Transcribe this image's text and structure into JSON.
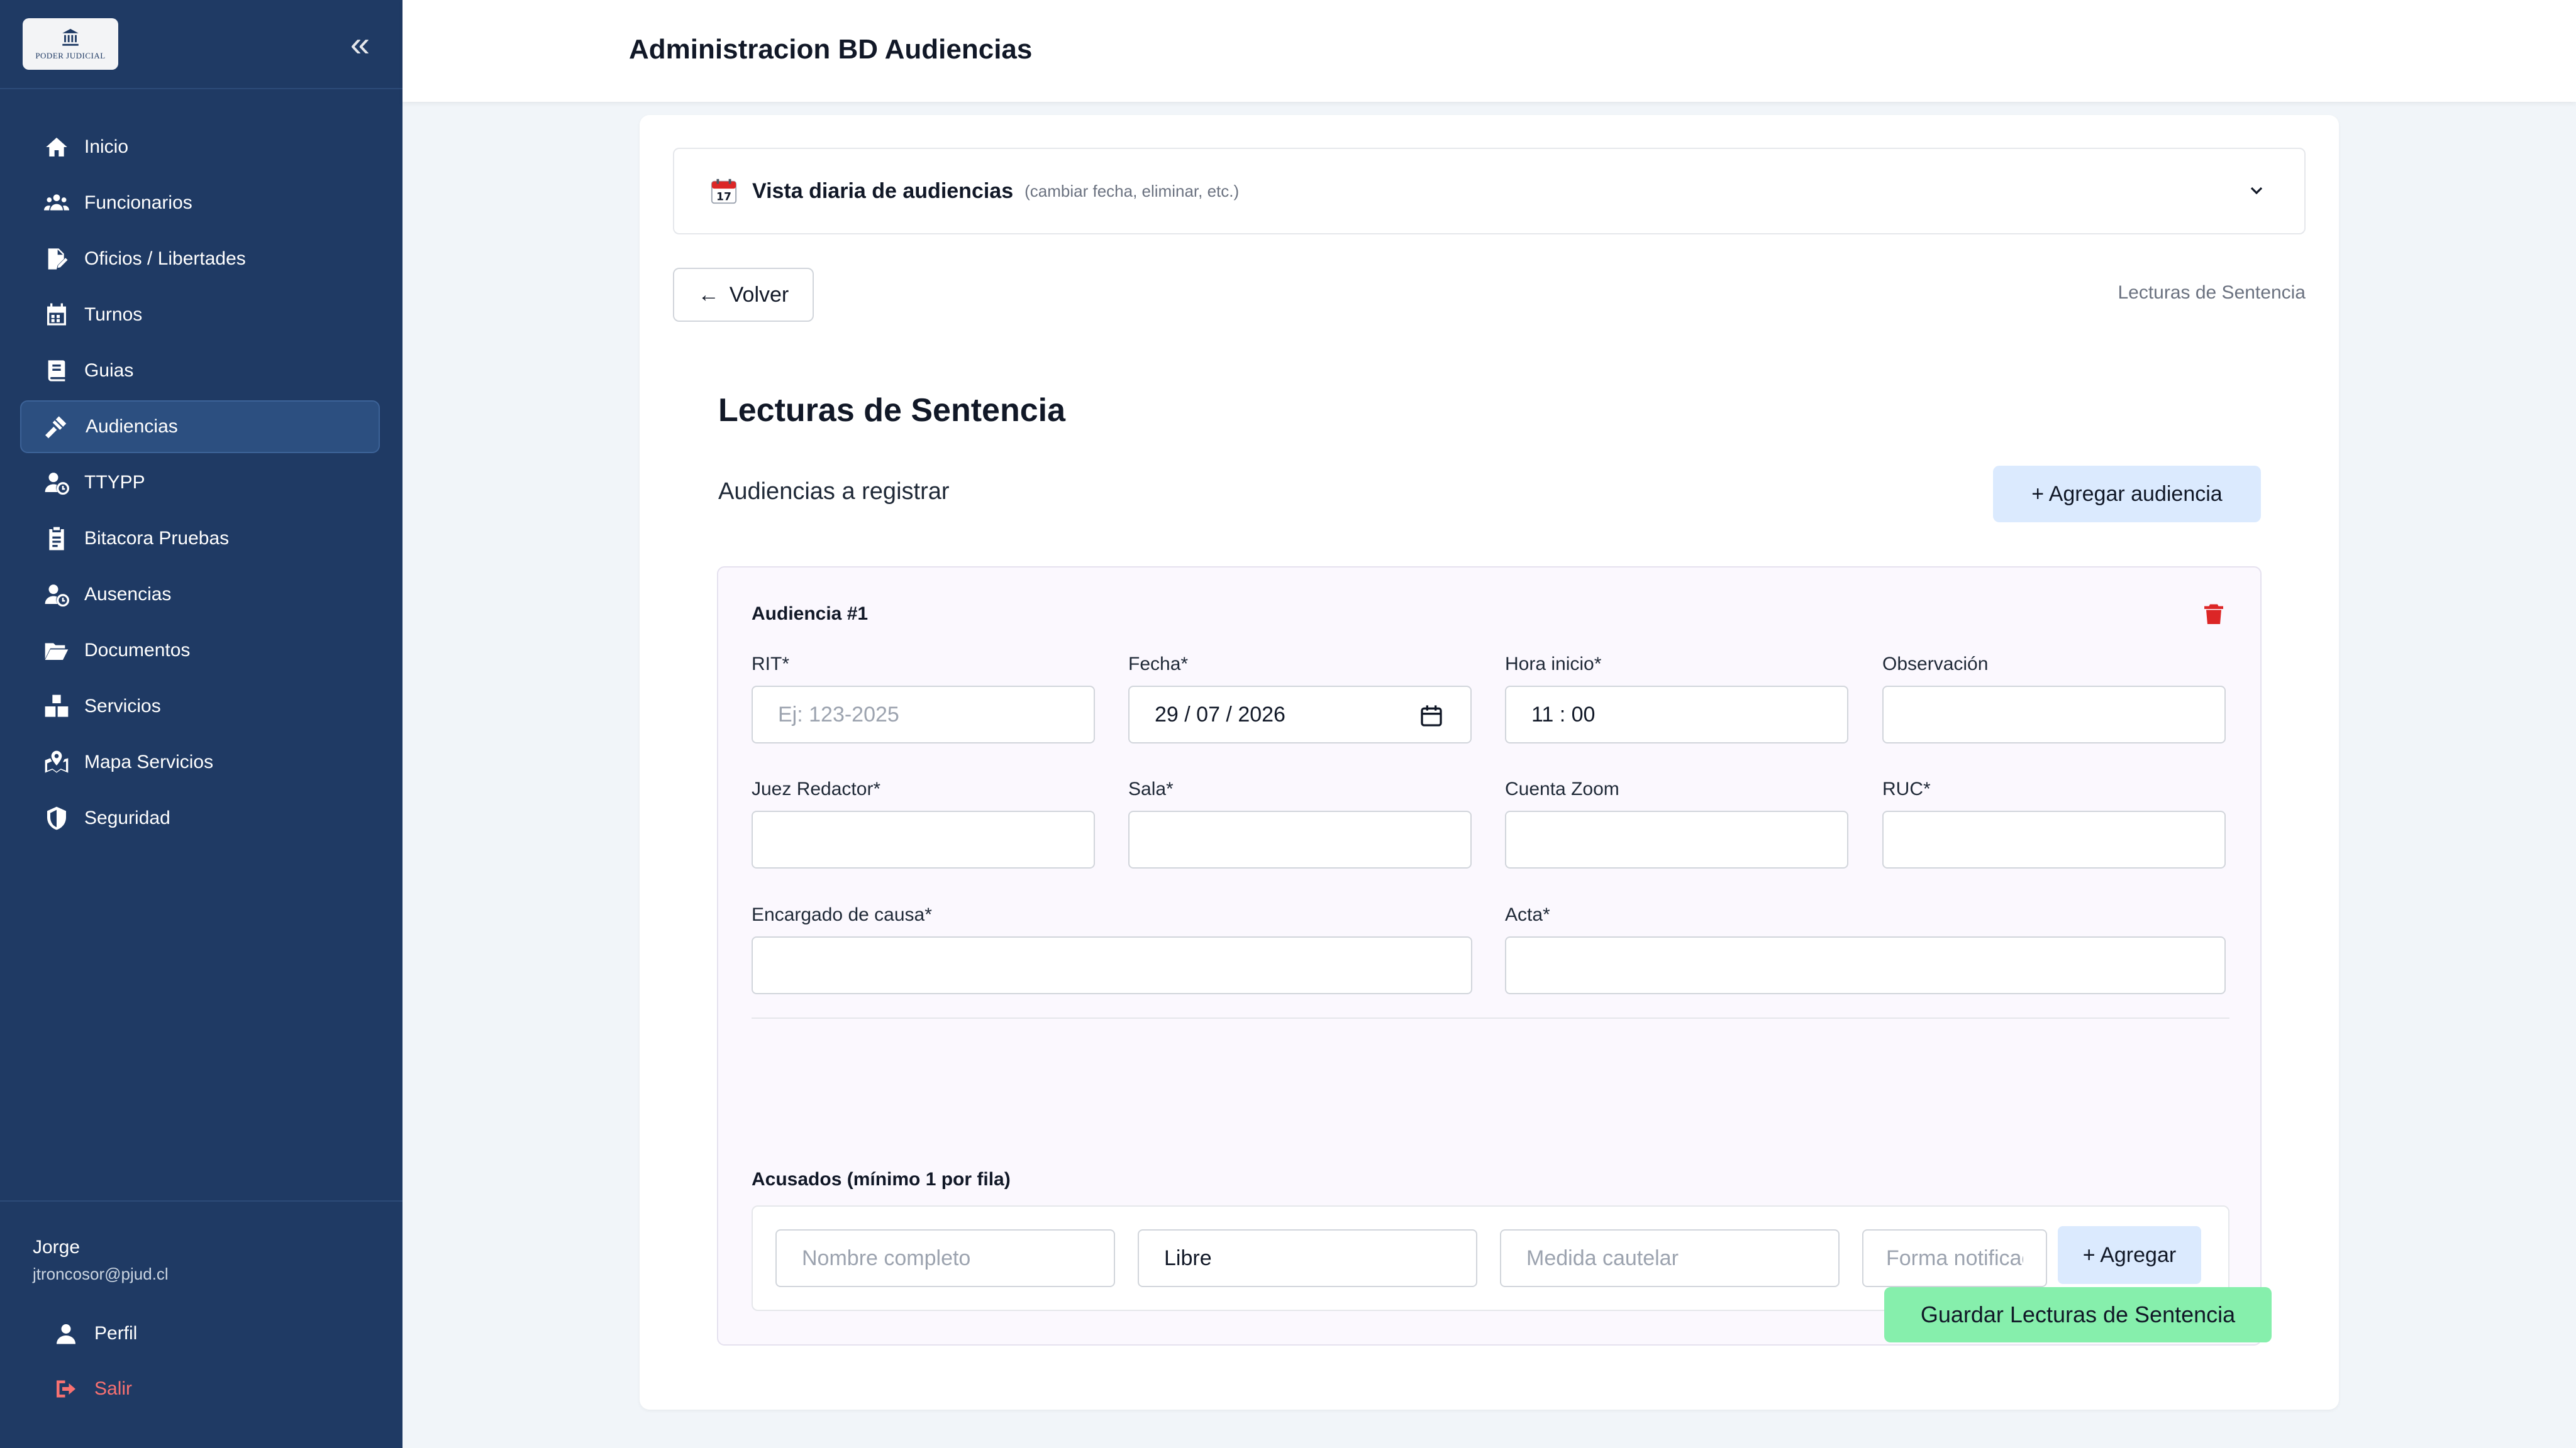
{
  "app": {
    "logo_text": "PODER JUDICIAL",
    "header_title": "Administracion BD Audiencias"
  },
  "sidebar": {
    "items": [
      {
        "label": "Inicio",
        "icon": "home-icon"
      },
      {
        "label": "Funcionarios",
        "icon": "users-icon"
      },
      {
        "label": "Oficios / Libertades",
        "icon": "file-signature-icon"
      },
      {
        "label": "Turnos",
        "icon": "calendar-icon"
      },
      {
        "label": "Guias",
        "icon": "book-icon"
      },
      {
        "label": "Audiencias",
        "icon": "gavel-icon",
        "active": true
      },
      {
        "label": "TTYPP",
        "icon": "user-clock-icon"
      },
      {
        "label": "Bitacora Pruebas",
        "icon": "clipboard-icon"
      },
      {
        "label": "Ausencias",
        "icon": "user-clock-icon"
      },
      {
        "label": "Documentos",
        "icon": "folder-open-icon"
      },
      {
        "label": "Servicios",
        "icon": "boxes-icon"
      },
      {
        "label": "Mapa Servicios",
        "icon": "map-marked-icon"
      },
      {
        "label": "Seguridad",
        "icon": "shield-icon"
      }
    ],
    "user": {
      "name": "Jorge",
      "email": "jtroncosor@pjud.cl"
    },
    "profile_label": "Perfil",
    "logout_label": "Salir"
  },
  "accordion": {
    "title": "Vista diaria de audiencias",
    "hint": "(cambiar fecha, eliminar, etc.)"
  },
  "nav": {
    "back_label": "Volver",
    "breadcrumb": "Lecturas de Sentencia"
  },
  "section": {
    "title": "Lecturas de Sentencia",
    "subtitle": "Audiencias a registrar",
    "add_label": "+ Agregar audiencia"
  },
  "audiencia": {
    "title": "Audiencia #1",
    "labels": {
      "rit": "RIT*",
      "fecha": "Fecha*",
      "hora": "Hora inicio*",
      "observacion": "Observación",
      "juez": "Juez Redactor*",
      "sala": "Sala*",
      "zoom": "Cuenta Zoom",
      "ruc": "RUC*",
      "encargado": "Encargado de causa*",
      "acta": "Acta*"
    },
    "rit_placeholder": "Ej: 123-2025",
    "fecha_value": "29 / 07 / 2026",
    "hora_value": "11 : 00",
    "acusados": {
      "label": "Acusados (mínimo 1 por fila)",
      "nombre_placeholder": "Nombre completo",
      "estado_value": "Libre",
      "medida_placeholder": "Medida cautelar",
      "forma_placeholder": "Forma notificación",
      "add_label": "+ Agregar"
    }
  },
  "save_label": "Guardar Lecturas de Sentencia",
  "colors": {
    "sidebar": "#1f3a64",
    "accent_blue": "#dbeafe",
    "save_green": "#86efac",
    "danger": "#dc2626"
  }
}
